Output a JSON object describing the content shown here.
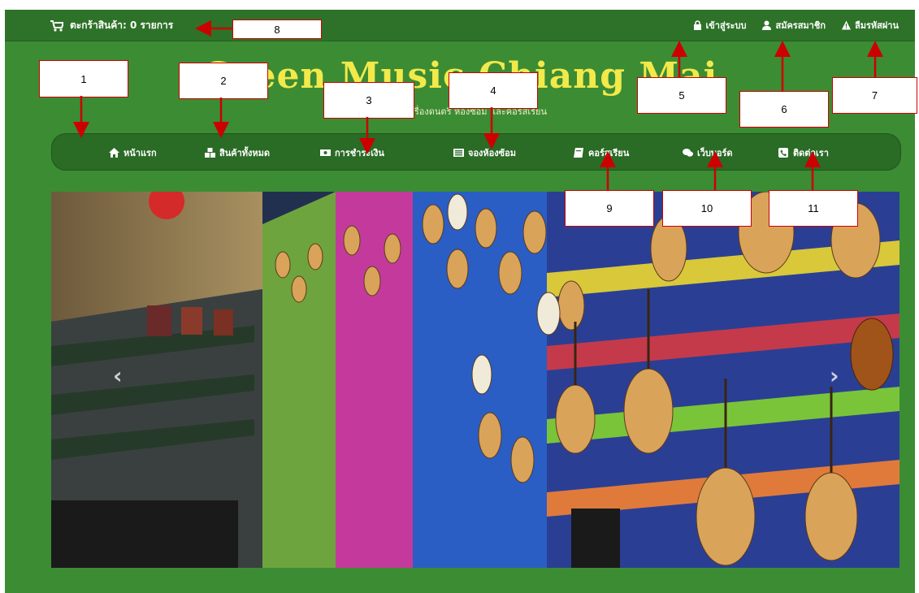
{
  "cart": {
    "label": "ตะกร้าสินค้า: 0 รายการ"
  },
  "top_links": [
    {
      "label": "เข้าสู่ระบบ",
      "icon": "lock-icon"
    },
    {
      "label": "สมัครสมาชิก",
      "icon": "user-icon"
    },
    {
      "label": "ลืมรหัสผ่าน",
      "icon": "warning-icon"
    }
  ],
  "site": {
    "title": "Green Music Chiang Mai",
    "subtitle": "ร้านขายเครื่องดนตรี ห้องซ้อม และคอร์สเรียน"
  },
  "nav": [
    {
      "label": "หน้าแรก",
      "icon": "home-icon"
    },
    {
      "label": "สินค้าทั้งหมด",
      "icon": "cubes-icon"
    },
    {
      "label": "การชำระเงิน",
      "icon": "money-icon"
    },
    {
      "label": "จองห้องซ้อม",
      "icon": "list-icon"
    },
    {
      "label": "คอร์สเรียน",
      "icon": "book-icon"
    },
    {
      "label": "เว็บบอร์ด",
      "icon": "chat-icon"
    },
    {
      "label": "ติดต่อเรา",
      "icon": "phone-icon"
    }
  ],
  "carousel": {
    "prev": "‹",
    "next": "›"
  },
  "callouts": [
    "1",
    "2",
    "3",
    "4",
    "5",
    "6",
    "7",
    "8",
    "9",
    "10",
    "11"
  ],
  "colors": {
    "page_green": "#3c8c34",
    "topbar": "#2d7228",
    "navbar": "#2a6b25",
    "title_yellow": "#f2e94a",
    "annotation_red": "#cc0000"
  }
}
